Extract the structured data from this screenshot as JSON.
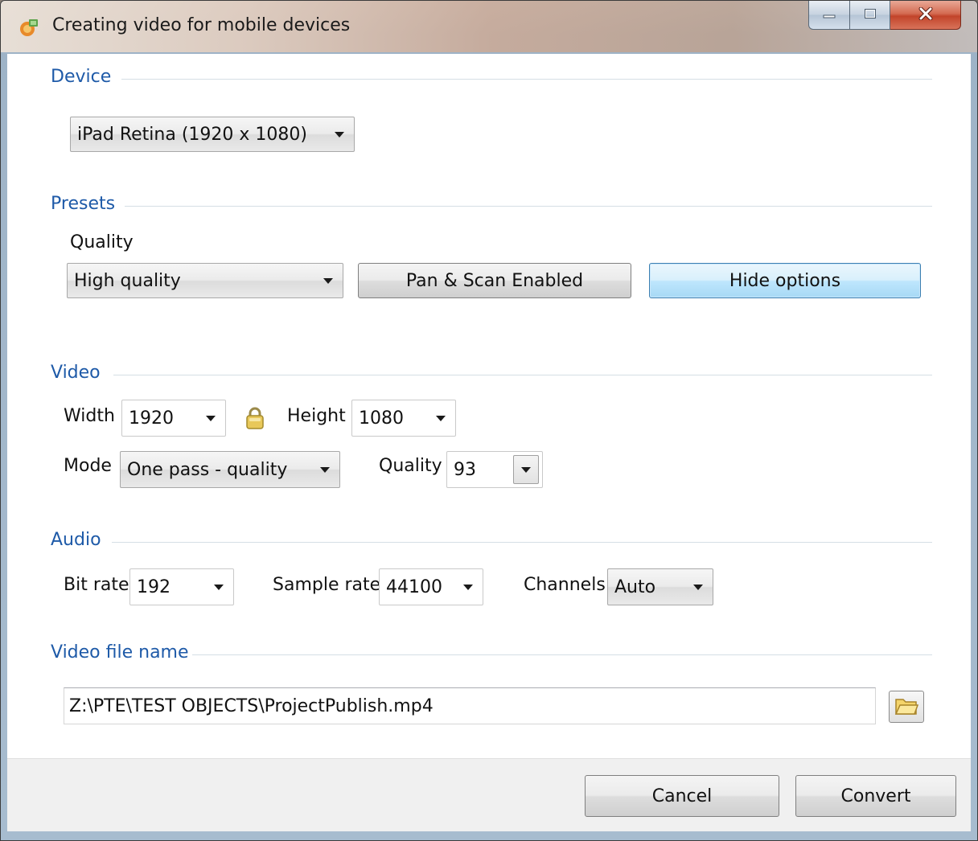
{
  "window": {
    "title": "Creating video for mobile devices"
  },
  "device": {
    "group_label": "Device",
    "selected": "iPad Retina (1920 x 1080)"
  },
  "presets": {
    "group_label": "Presets",
    "quality_label": "Quality",
    "quality_selected": "High quality",
    "pan_scan_button": "Pan & Scan Enabled",
    "hide_options_button": "Hide options"
  },
  "video": {
    "group_label": "Video",
    "width_label": "Width",
    "width_value": "1920",
    "height_label": "Height",
    "height_value": "1080",
    "mode_label": "Mode",
    "mode_value": "One pass - quality",
    "quality_label": "Quality",
    "quality_value": "93"
  },
  "audio": {
    "group_label": "Audio",
    "bitrate_label": "Bit rate",
    "bitrate_value": "192",
    "samplerate_label": "Sample rate",
    "samplerate_value": "44100",
    "channels_label": "Channels",
    "channels_value": "Auto"
  },
  "filename": {
    "group_label": "Video file name",
    "value": "Z:\\PTE\\TEST OBJECTS\\ProjectPublish.mp4"
  },
  "footer": {
    "cancel_button": "Cancel",
    "convert_button": "Convert"
  },
  "icons": {
    "app": "app-icon",
    "lock": "lock-icon",
    "browse": "folder-open-icon"
  }
}
